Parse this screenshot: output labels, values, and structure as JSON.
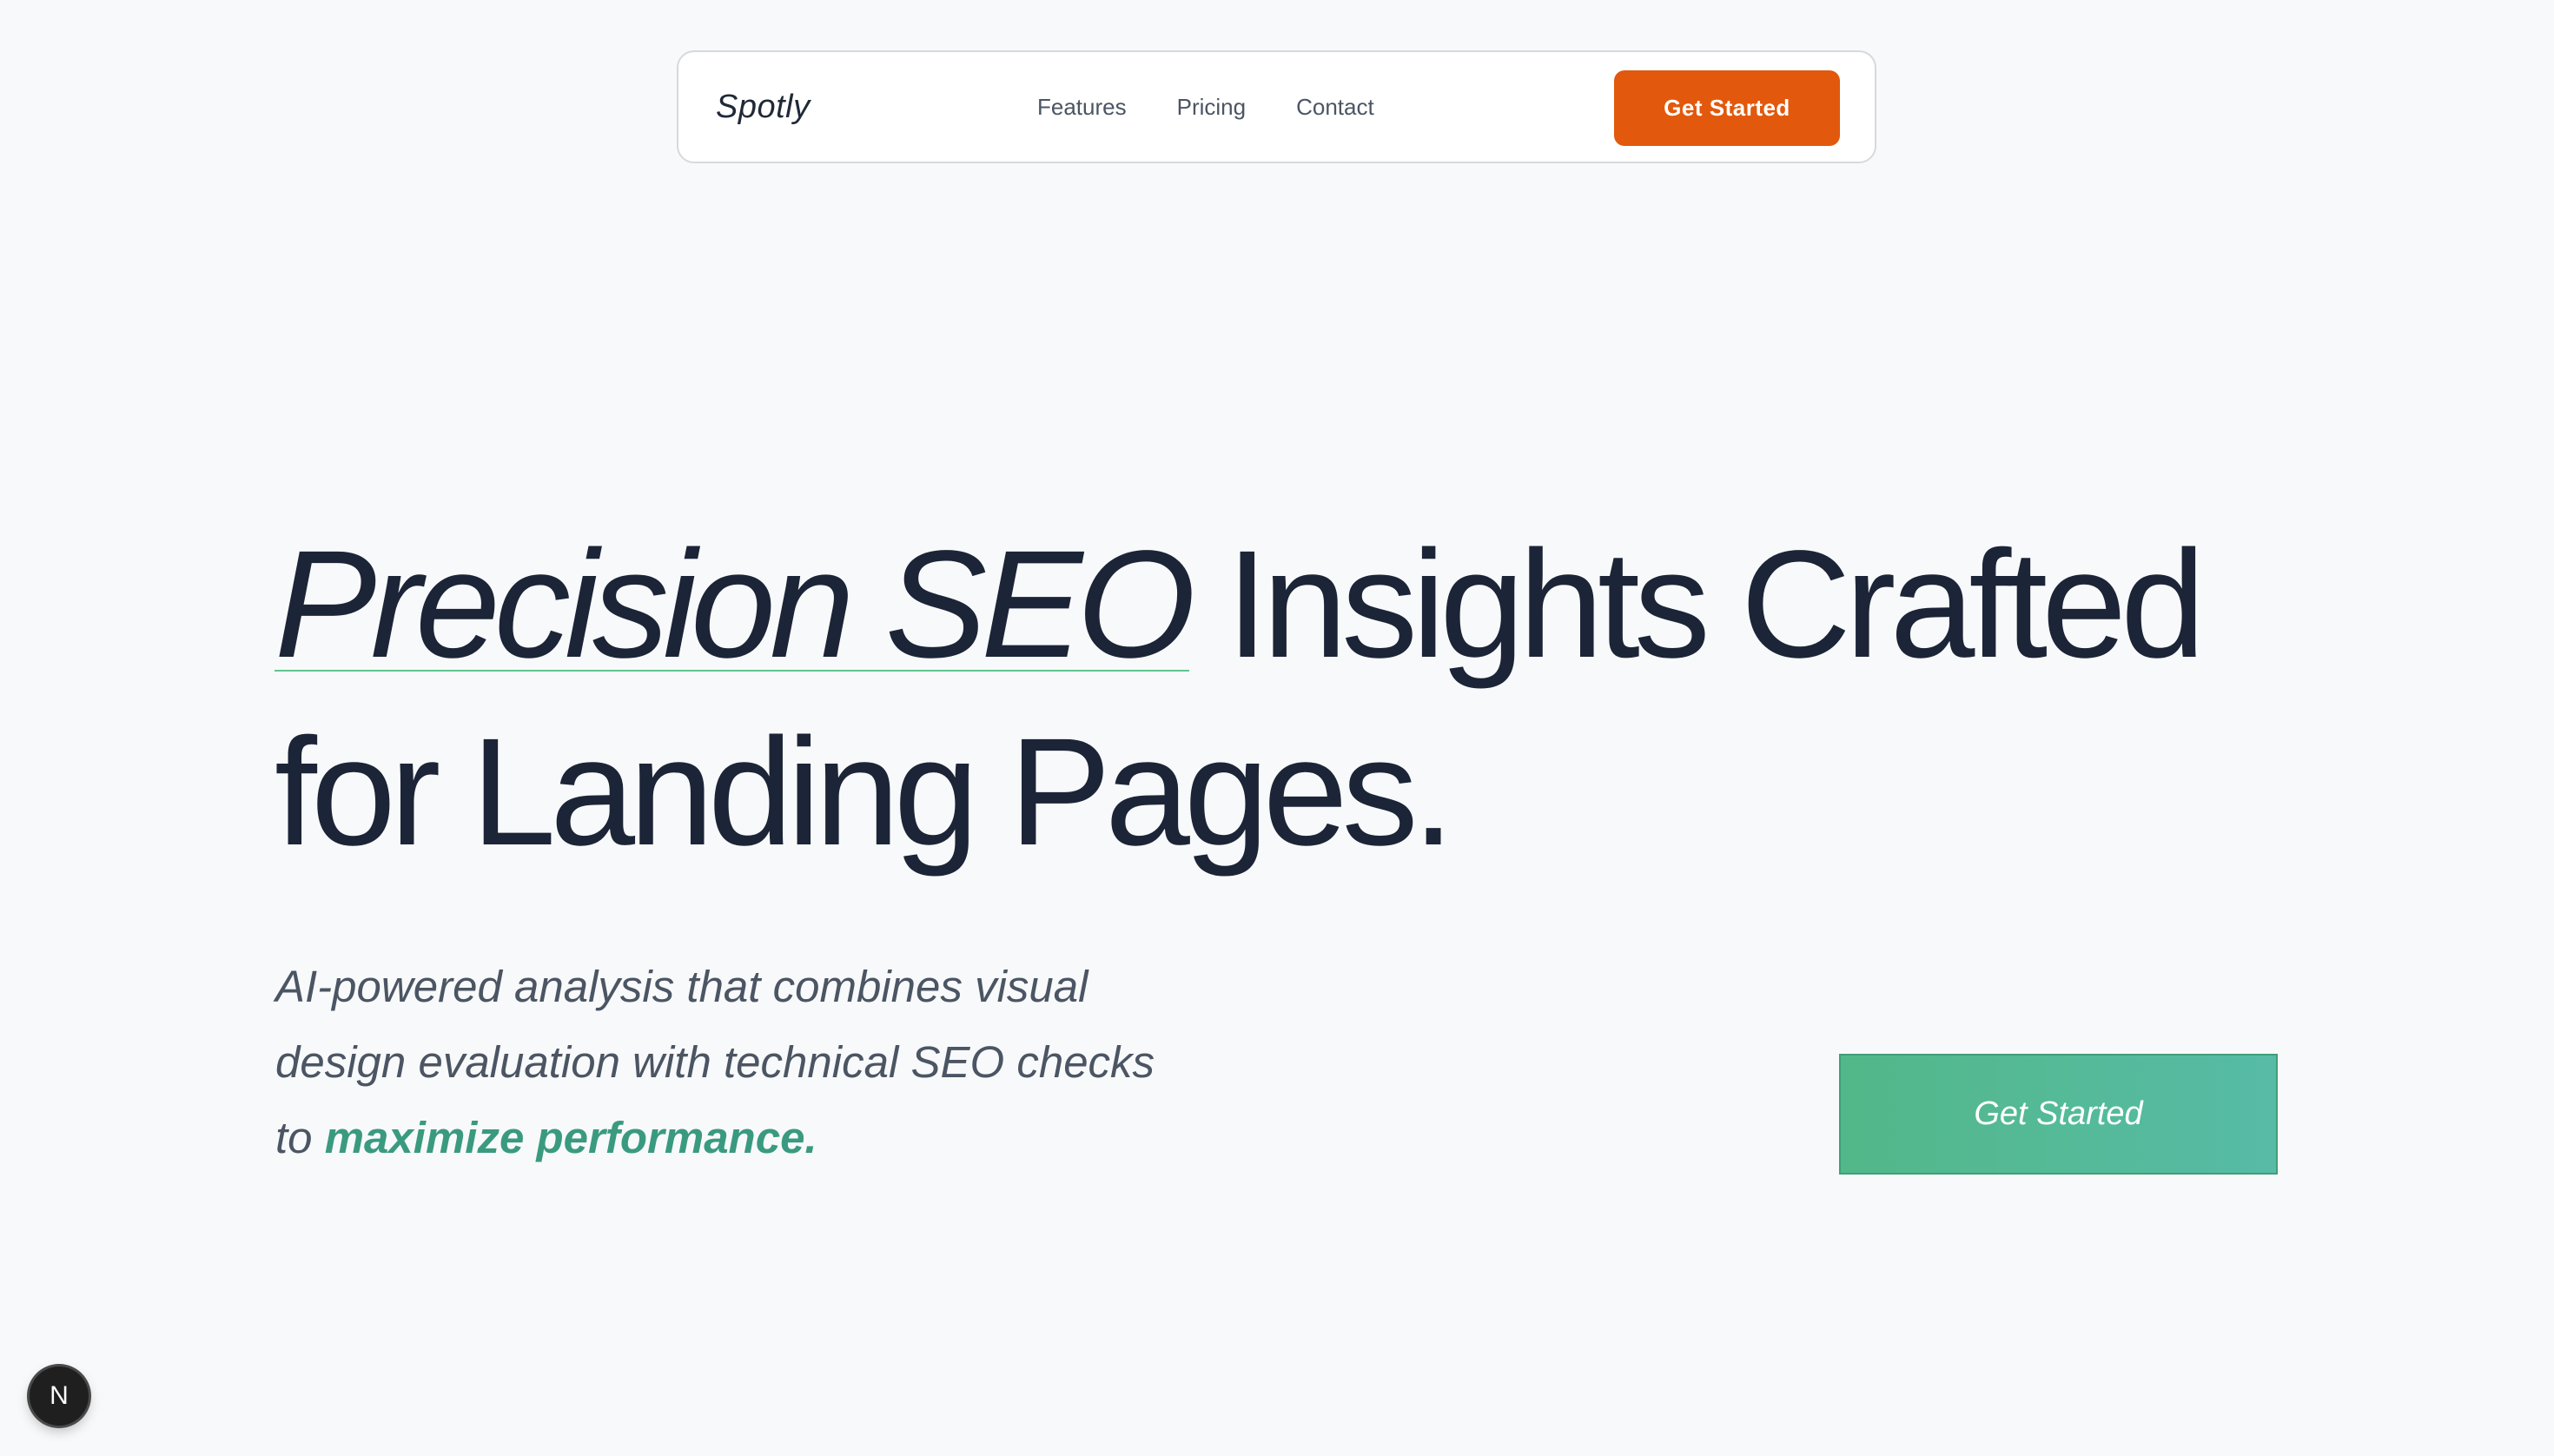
{
  "navbar": {
    "brand": "Spotly",
    "links": [
      "Features",
      "Pricing",
      "Contact"
    ],
    "cta_label": "Get Started"
  },
  "hero": {
    "title_accent": "Precision SEO",
    "title_rest": " Insights Crafted for Landing Pages.",
    "subtitle_main": "AI-powered analysis that combines visual design evaluation with technical SEO checks to ",
    "subtitle_highlight": "maximize performance.",
    "cta_label": "Get Started"
  },
  "dev_badge": {
    "label": "N"
  },
  "colors": {
    "background": "#f8f9fa",
    "nav_cta": "#e2580c",
    "hero_cta_gradient_start": "#52b889",
    "hero_cta_gradient_end": "#57bba6",
    "highlight": "#3a9a80",
    "title": "#1c2537"
  }
}
